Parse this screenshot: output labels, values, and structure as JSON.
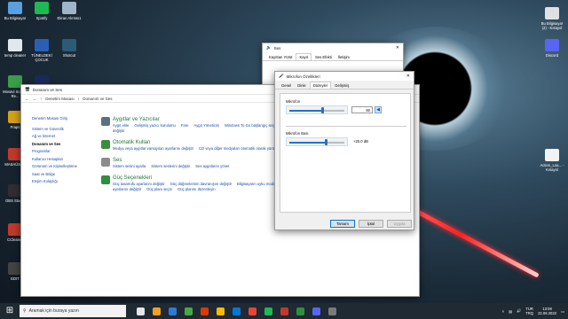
{
  "desktop": {
    "icons_left": [
      {
        "label": "Bu Bilgisayar",
        "color": "#5aa0e0"
      },
      {
        "label": "Spotify",
        "color": "#1db954"
      },
      {
        "label": "Ekran Alıntısı1",
        "color": "#9fb6c8"
      },
      {
        "label": "temp cleaner",
        "color": "#dfe8ef"
      },
      {
        "label": "TÜNELDEKİ ÇOCUK",
        "color": "#2b5fb3"
      },
      {
        "label": "Shotcut",
        "color": "#2c5b7a"
      },
      {
        "label": "Movavi Screen Re...",
        "color": "#3a9d4a"
      },
      {
        "label": "PES",
        "color": "#1a2a5a"
      },
      {
        "label": "Fraps",
        "color": "#d4a017"
      },
      {
        "label": "MASAÜSTÜ",
        "color": "#c0392b"
      },
      {
        "label": "OBS Studio",
        "color": "#302e31"
      },
      {
        "label": "CCleaner",
        "color": "#c0392b"
      },
      {
        "label": "EDIT",
        "color": "#444444"
      }
    ],
    "icons_right": [
      {
        "label": "Bu Bilgisayar (2) - Kısayol",
        "color": "#e0e0e0"
      },
      {
        "label": "Discord",
        "color": "#5865f2"
      },
      {
        "label": "Action_Loa... - Kısayol",
        "color": "#f2f2f2"
      }
    ]
  },
  "control_panel": {
    "title": "Donanım ve Ses",
    "breadcrumb": [
      "Denetim Masası",
      "Donanım ve Ses"
    ],
    "left_nav": {
      "home": "Denetim Masası Giriş",
      "items": [
        "Sistem ve Güvenlik",
        "Ağ ve İnternet",
        "Donanım ve Ses",
        "Programlar",
        "Kullanıcı Hesapları",
        "Görünüm ve Kişiselleştirme",
        "Saat ve Bölge",
        "Erişim Kolaylığı"
      ],
      "active_index": 2
    },
    "categories": [
      {
        "title": "Aygıtlar ve Yazıcılar",
        "color": "#5e6f80",
        "links": [
          "Aygıt ekle",
          "Gelişmiş yazıcı kurulumu",
          "Fare",
          "Aygıt Yöneticisi",
          "Windows To Go başlangıç seçeneklerini değiştir"
        ]
      },
      {
        "title": "Otomatik Kullan",
        "color": "#3b8c3b",
        "links": [
          "Medya veya aygıtlar varsayılan ayarlarını değiştir",
          "CD veya diğer medyaları otomatik olarak yürüt"
        ]
      },
      {
        "title": "Ses",
        "color": "#8c8c8c",
        "links": [
          "Sistem sesini ayarla",
          "Sistem seslerini değiştir",
          "Ses aygıtlarını yönet"
        ]
      },
      {
        "title": "Güç Seçenekleri",
        "color": "#2f8f3f",
        "links": [
          "Güç tasarrufu ayarlarını değiştir",
          "Güç düğmelerinin davranışını değiştir",
          "Bilgisayarın uyku moduna geçme ayarlarını değiştir",
          "Güç planı seçin",
          "Güç planını düzenleyin"
        ]
      }
    ]
  },
  "sound_dialog": {
    "title": "Ses",
    "tabs": [
      "Kayıttan Yürüt",
      "Kayıt",
      "Ses Efekti",
      "İletişim"
    ],
    "selected_tab": 1
  },
  "mic_dialog": {
    "title": "Mikrofon Özellikleri",
    "tabs": [
      "Genel",
      "Dinle",
      "Düzeyler",
      "Gelişmiş"
    ],
    "selected_tab": 2,
    "mic_label": "Mikrofon",
    "mic_value": "60",
    "mic_level": 0.6,
    "boost_label": "Mikrofon Bası",
    "boost_value": "+20.0 dB",
    "boost_level": 0.67,
    "buttons": {
      "ok": "Tamam",
      "cancel": "İptal",
      "apply": "Uygula"
    }
  },
  "taskbar": {
    "search_placeholder": "Aramak için buraya yazın",
    "apps": [
      "#e6e6e6",
      "#f0a020",
      "#2b7bd8",
      "#44aa44",
      "#d83b01",
      "#ffb900",
      "#0078d7",
      "#ea4335",
      "#1db954",
      "#c0392b",
      "#2f8f3f",
      "#5865f2",
      "#7a7a7a"
    ],
    "lang": "TUR",
    "lang2": "TRQ",
    "time": "13:08",
    "date": "22.08.2022"
  }
}
